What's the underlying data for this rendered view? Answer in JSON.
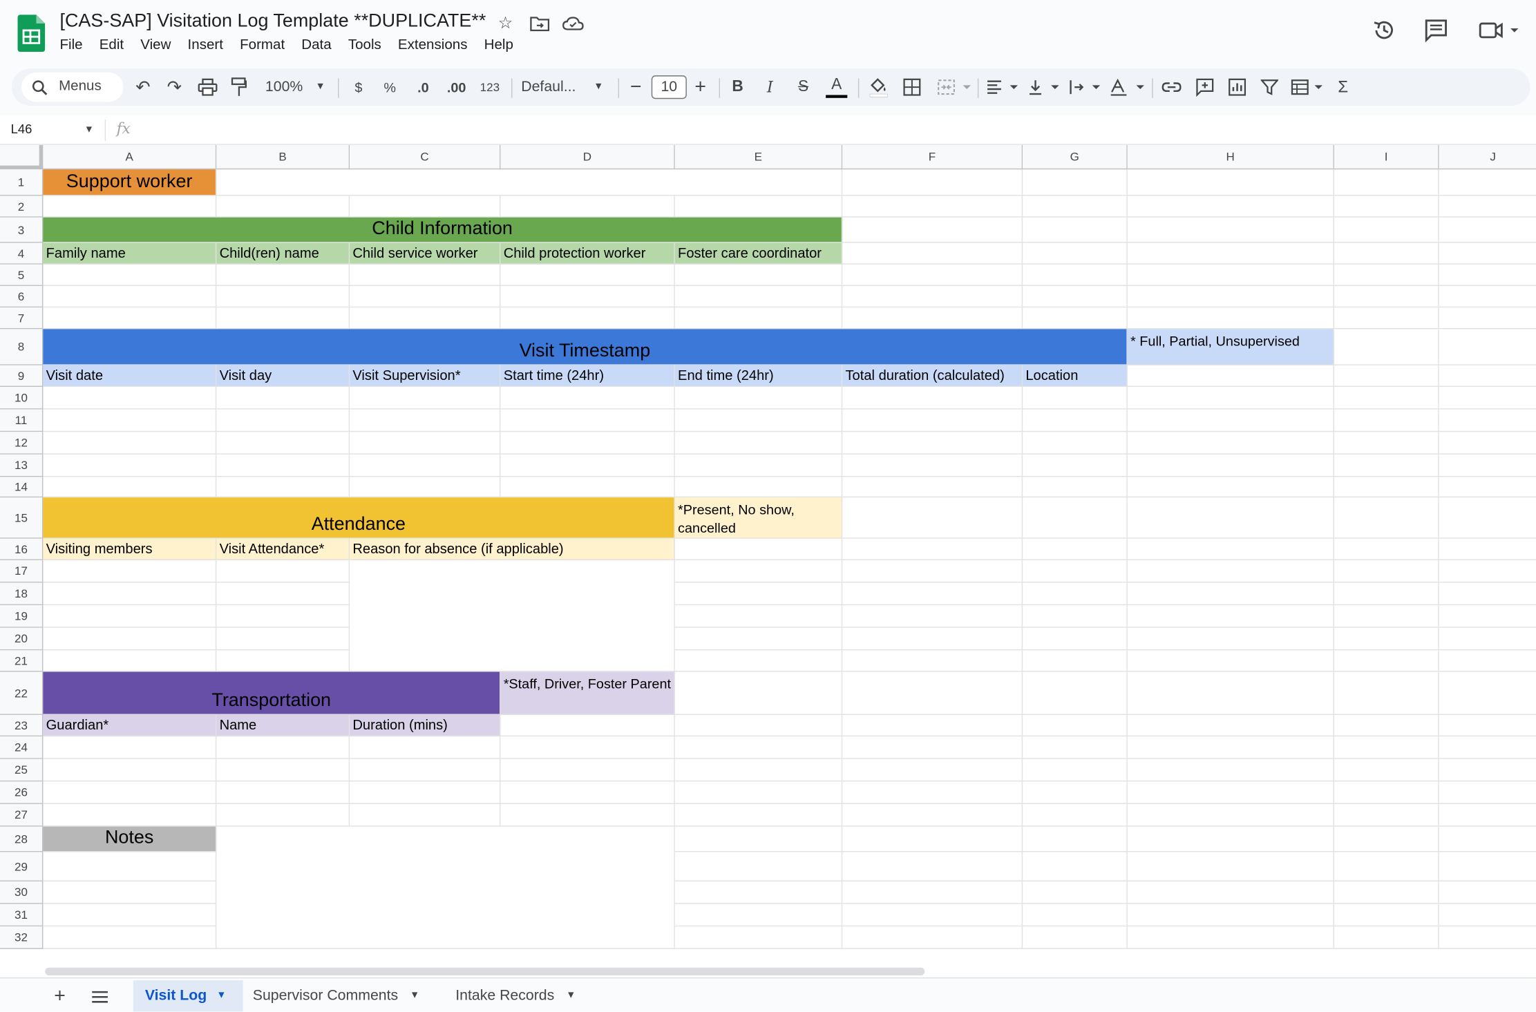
{
  "app": {
    "doc_title": "[CAS-SAP] Visitation Log Template **DUPLICATE**",
    "menus": [
      "File",
      "Edit",
      "View",
      "Insert",
      "Format",
      "Data",
      "Tools",
      "Extensions",
      "Help"
    ],
    "colors": {
      "accent": "#0b57d0",
      "sheets_green": "#0f9d58"
    }
  },
  "toolbar": {
    "search_label": "Menus",
    "zoom": "100%",
    "currency": "$",
    "percent": "%",
    "decrease_decimal": ".0",
    "increase_decimal": ".00",
    "number_format": "123",
    "font": "Defaul...",
    "font_size": "10"
  },
  "formula_bar": {
    "cell_ref": "L46",
    "fx": "fx"
  },
  "columns": [
    "A",
    "B",
    "C",
    "D",
    "E",
    "F",
    "G",
    "H",
    "I",
    "J"
  ],
  "rows": [
    "1",
    "2",
    "3",
    "4",
    "5",
    "6",
    "7",
    "8",
    "9",
    "10",
    "11",
    "12",
    "13",
    "14",
    "15",
    "16",
    "17",
    "18",
    "19",
    "20",
    "21",
    "22",
    "23",
    "24",
    "25",
    "26",
    "27",
    "28",
    "29",
    "30",
    "31",
    "32"
  ],
  "cells": {
    "support_worker": "Support worker",
    "child_info_header": "Child Information",
    "child_info_cols": [
      "Family name",
      "Child(ren) name",
      "Child service worker",
      "Child protection worker",
      "Foster care coordinator"
    ],
    "visit_timestamp_header": "Visit Timestamp",
    "visit_supervision_note": "* Full, Partial, Unsupervised",
    "visit_cols": [
      "Visit date",
      "Visit day",
      "Visit Supervision*",
      "Start time (24hr)",
      "End time (24hr)",
      "Total duration (calculated)",
      "Location"
    ],
    "attendance_header": "Attendance",
    "attendance_note": "*Present, No show, cancelled",
    "attendance_cols": [
      "Visiting members",
      "Visit Attendance*",
      "Reason for absence (if applicable)"
    ],
    "transportation_header": "Transportation",
    "transportation_note": "*Staff, Driver, Foster Parent",
    "transportation_cols": [
      "Guardian*",
      "Name",
      "Duration (mins)"
    ],
    "notes_header": "Notes"
  },
  "section_colors": {
    "support_worker": "#e69138",
    "child_info": "#6aa84f",
    "child_info_light": "#b6d7a8",
    "visit_timestamp": "#3c78d8",
    "visit_light": "#c9daf8",
    "attendance": "#f1c232",
    "attendance_light": "#fff2cc",
    "transportation": "#674ea7",
    "transportation_light": "#d9d2e9",
    "notes": "#b7b7b7"
  },
  "sheets": {
    "tabs": [
      "Visit Log",
      "Supervisor Comments",
      "Intake Records"
    ],
    "active": "Visit Log"
  }
}
